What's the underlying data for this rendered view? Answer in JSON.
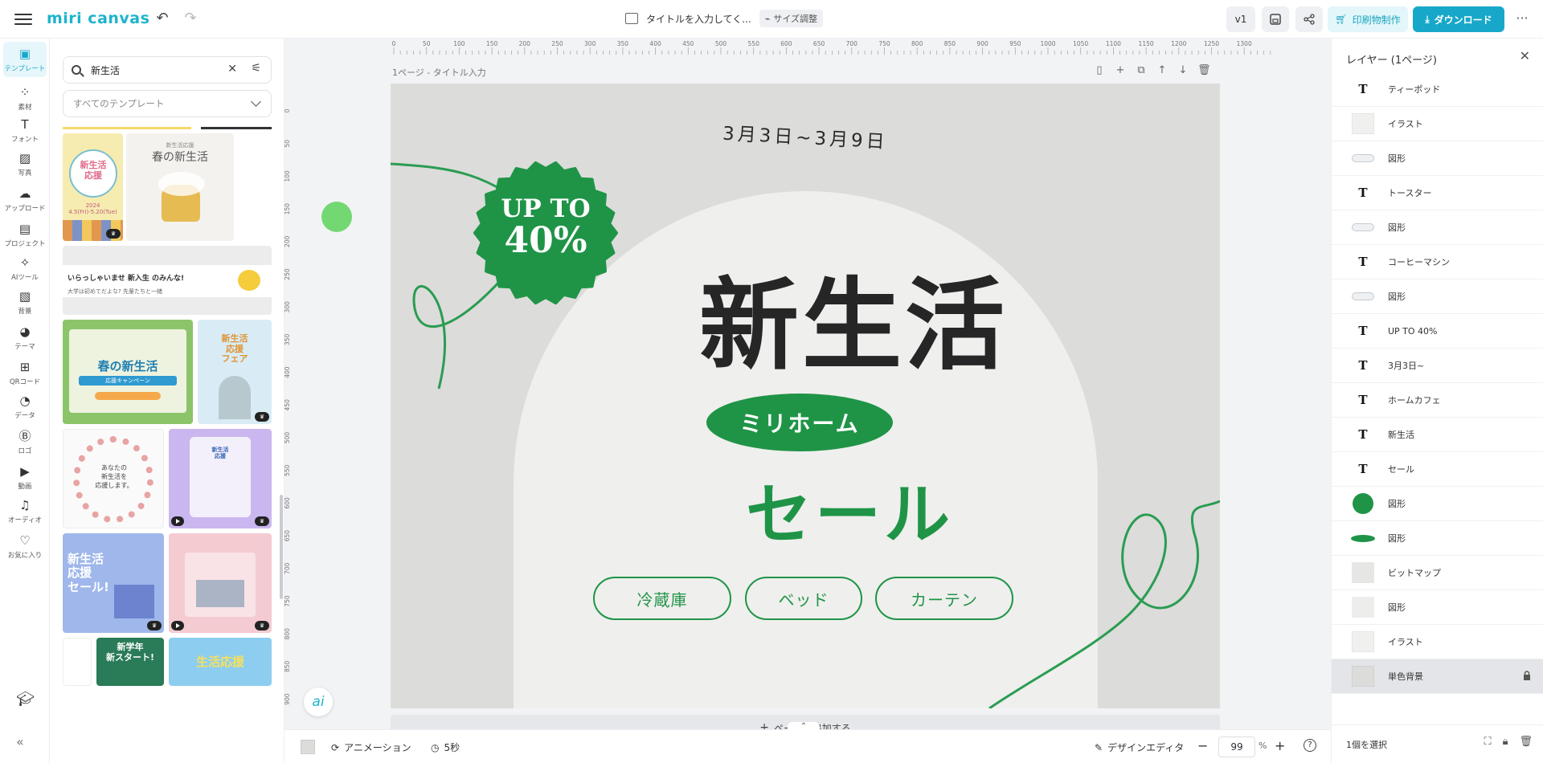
{
  "topbar": {
    "logo": "miri canvas",
    "doc_title": "タイトルを入力してく...",
    "resize_label": "サイズ調整",
    "version": "v1",
    "print_label": "印刷物制作",
    "download_label": "ダウンロード",
    "more": "···"
  },
  "rail": [
    {
      "label": "テンプレート",
      "icon": "template-icon",
      "glyph": "▣",
      "active": true
    },
    {
      "label": "素材",
      "icon": "elements-icon",
      "glyph": "⁘"
    },
    {
      "label": "フォント",
      "icon": "font-icon",
      "glyph": "T"
    },
    {
      "label": "写真",
      "icon": "photo-icon",
      "glyph": "▨"
    },
    {
      "label": "アップロード",
      "icon": "upload-icon",
      "glyph": "☁"
    },
    {
      "label": "プロジェクト",
      "icon": "project-icon",
      "glyph": "▤"
    },
    {
      "label": "AIツール",
      "icon": "ai-tools-icon",
      "glyph": "✧"
    },
    {
      "label": "背景",
      "icon": "background-icon",
      "glyph": "▧"
    },
    {
      "label": "テーマ",
      "icon": "theme-icon",
      "glyph": "◕"
    },
    {
      "label": "QRコード",
      "icon": "qr-icon",
      "glyph": "⊞"
    },
    {
      "label": "データ",
      "icon": "data-icon",
      "glyph": "◔"
    },
    {
      "label": "ロゴ",
      "icon": "logo-icon",
      "glyph": "Ⓑ"
    },
    {
      "label": "動画",
      "icon": "video-icon",
      "glyph": "▶"
    },
    {
      "label": "オーディオ",
      "icon": "audio-icon",
      "glyph": "♫"
    },
    {
      "label": "お気に入り",
      "icon": "heart-icon",
      "glyph": "♡"
    }
  ],
  "panel": {
    "search_value": "新生活",
    "filter_label": "すべてのテンプレート",
    "templates": {
      "t1": {
        "title": "新生活\n応援",
        "sub": "2024\n4.5(Fri)-5.20(Tue)"
      },
      "t2": {
        "title": "春の新生活",
        "sub": "新生活応援"
      },
      "t3": {
        "title": "いらっしゃいませ 新入生 のみんな!",
        "sub": "大学は初めてだよな? 先輩たちと一緒"
      },
      "t4": {
        "title": "春の新生活",
        "sub": "応援キャンペーン"
      },
      "t5": {
        "title": "新生活\n応援\nフェア",
        "sub": ""
      },
      "t6": {
        "title": "あなたの\n新生活を\n応援します。",
        "sub": ""
      },
      "t7": {
        "title": "新生活\n応援\nセール!",
        "sub": ""
      },
      "t8": {
        "title": "新学年\n新スタート!",
        "sub": ""
      },
      "t9": {
        "title": "生活応援",
        "sub": ""
      }
    }
  },
  "canvas": {
    "page_label": "1ページ - タイトル入力",
    "date": "3月3日~3月9日",
    "badge_line1": "UP TO",
    "badge_line2": "40%",
    "main_title": "新生活",
    "store": "ミリホーム",
    "sale": "セール",
    "categories": [
      "冷蔵庫",
      "ベッド",
      "カーテン"
    ],
    "add_page": "ページを追加する",
    "ai": "ai",
    "ruler_ticks": [
      "0",
      "50",
      "100",
      "150",
      "200",
      "250",
      "300",
      "350",
      "400",
      "450",
      "500",
      "550",
      "600",
      "650",
      "700",
      "750",
      "800",
      "850",
      "900",
      "950",
      "1000",
      "1050",
      "1100",
      "1150",
      "1200",
      "1250",
      "1300"
    ],
    "ruler_left_ticks": [
      "0",
      "50",
      "100",
      "150",
      "200",
      "250",
      "300",
      "350",
      "400",
      "450",
      "500",
      "550",
      "600",
      "650",
      "700",
      "750",
      "800",
      "850",
      "900"
    ],
    "accent_green": "#1f9447"
  },
  "bottombar": {
    "animation": "アニメーション",
    "duration": "5秒",
    "design_editor": "デザインエディタ",
    "zoom": "99",
    "zoom_unit": "%"
  },
  "layers": {
    "title": "レイヤー (1ページ)",
    "items": [
      {
        "label": "ティーポッド",
        "type": "text"
      },
      {
        "label": "イラスト",
        "type": "illust"
      },
      {
        "label": "図形",
        "type": "shape-pill"
      },
      {
        "label": "トースター",
        "type": "text"
      },
      {
        "label": "図形",
        "type": "shape-pill"
      },
      {
        "label": "コーヒーマシン",
        "type": "text"
      },
      {
        "label": "図形",
        "type": "shape-pill"
      },
      {
        "label": "UP TO 40%",
        "type": "text"
      },
      {
        "label": "3月3日~",
        "type": "text"
      },
      {
        "label": "ホームカフェ",
        "type": "text"
      },
      {
        "label": "新生活",
        "type": "text"
      },
      {
        "label": "セール",
        "type": "text"
      },
      {
        "label": "図形",
        "type": "shape-circle"
      },
      {
        "label": "図形",
        "type": "shape-ellipse"
      },
      {
        "label": "ビットマップ",
        "type": "bitmap"
      },
      {
        "label": "図形",
        "type": "shape-gray"
      },
      {
        "label": "イラスト",
        "type": "illust"
      },
      {
        "label": "単色背景",
        "type": "bg",
        "selected": true,
        "locked": true
      }
    ],
    "selection_count": "1個を選択"
  }
}
